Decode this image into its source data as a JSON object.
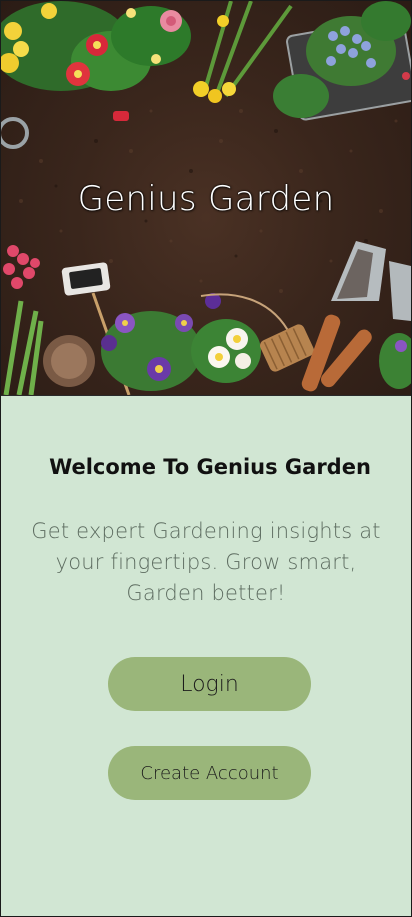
{
  "hero": {
    "title": "Genius Garden"
  },
  "welcome": {
    "heading": "Welcome To Genius Garden",
    "tagline": "Get expert Gardening insights at your fingertips. Grow smart, Garden better!"
  },
  "actions": {
    "login_label": "Login",
    "create_account_label": "Create Account"
  },
  "colors": {
    "panel_background": "#d1e6d3",
    "button_background": "#9ab67a",
    "soil": "#3a261c"
  }
}
